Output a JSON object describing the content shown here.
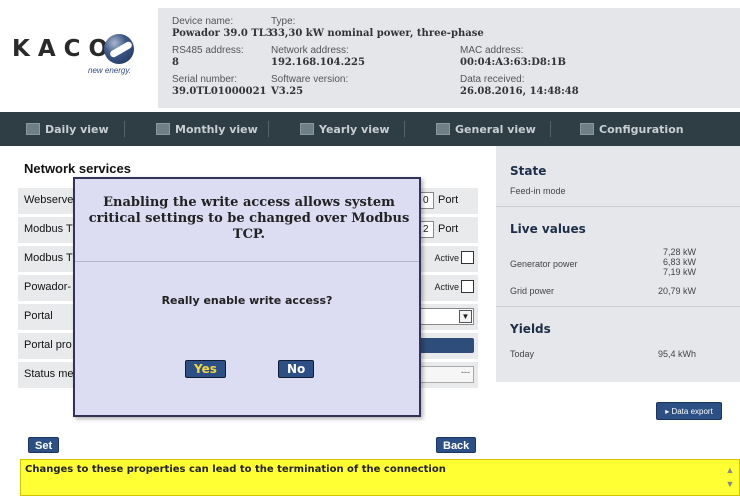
{
  "header": {
    "logo_text": "KACO",
    "logo_tagline": "new energy.",
    "device_name_label": "Device name:",
    "device_name_value": "Powador 39.0 TL3",
    "type_label": "Type:",
    "type_value": "33,30 kW nominal power, three-phase",
    "rs485_label": "RS485 address:",
    "rs485_value": "8",
    "network_label": "Network address:",
    "network_value": "192.168.104.225",
    "mac_label": "MAC address:",
    "mac_value": "00:04:A3:63:D8:1B",
    "serial_label": "Serial number:",
    "serial_value": "39.0TL01000021",
    "software_label": "Software version:",
    "software_value": "V3.25",
    "data_received_label": "Data received:",
    "data_received_value": "26.08.2016, 14:48:48"
  },
  "nav": {
    "items": [
      {
        "label": "Daily view"
      },
      {
        "label": "Monthly view"
      },
      {
        "label": "Yearly view"
      },
      {
        "label": "General view"
      },
      {
        "label": "Configuration"
      }
    ]
  },
  "main": {
    "title": "Network services",
    "rows": [
      {
        "label": "Webserve",
        "port_value": "0",
        "port_label": "Port"
      },
      {
        "label": "Modbus T",
        "port_value": "2",
        "port_label": "Port"
      },
      {
        "label": "Modbus T",
        "active_label": "Active"
      },
      {
        "label": "Powador-",
        "active_label": "Active"
      },
      {
        "label": "Portal"
      },
      {
        "label": "Portal pro"
      },
      {
        "label": "Status me",
        "status_value": "---"
      }
    ],
    "set_label": "Set",
    "back_label": "Back"
  },
  "sidebar": {
    "state_title": "State",
    "state_value": "Feed-in mode",
    "live_title": "Live values",
    "generator_label": "Generator power",
    "generator_values": [
      "7,28 kW",
      "6,83 kW",
      "7,19 kW"
    ],
    "grid_label": "Grid power",
    "grid_value": "20,79 kW",
    "yields_title": "Yields",
    "today_label": "Today",
    "today_value": "95,4 kWh",
    "export_label": "▸ Data export"
  },
  "footer": {
    "message": "Changes to these properties can lead to the termination of the connection"
  },
  "modal": {
    "message": "Enabling the write access allows system critical settings to be changed over Modbus TCP.",
    "question": "Really enable write access?",
    "yes_label": "Yes",
    "no_label": "No"
  }
}
